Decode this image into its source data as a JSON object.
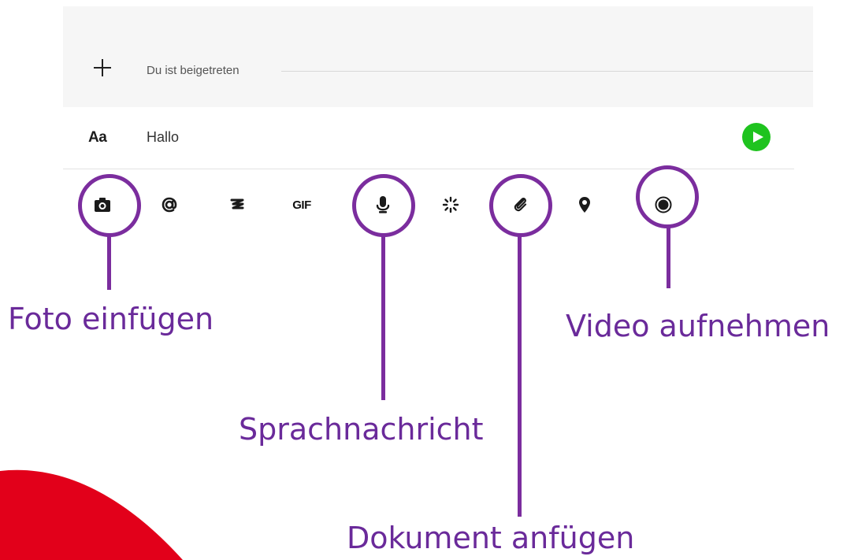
{
  "chat": {
    "system_message": "Du ist beigetreten",
    "format_label": "Aa",
    "message_value": "Hallo"
  },
  "toolbar": {
    "gif_label": "GIF",
    "icons": [
      "camera-icon",
      "mention-icon",
      "sticker-icon",
      "gif-icon",
      "microphone-icon",
      "sparkle-icon",
      "paperclip-icon",
      "location-pin-icon",
      "record-video-icon"
    ]
  },
  "annotations": {
    "photo": "Foto einfügen",
    "voice": "Sprachnachricht",
    "document": "Dokument anfügen",
    "video": "Video aufnehmen"
  },
  "colors": {
    "accent_purple": "#7b2d9e",
    "send_green": "#1fc31f",
    "decor_red": "#e2001a"
  }
}
